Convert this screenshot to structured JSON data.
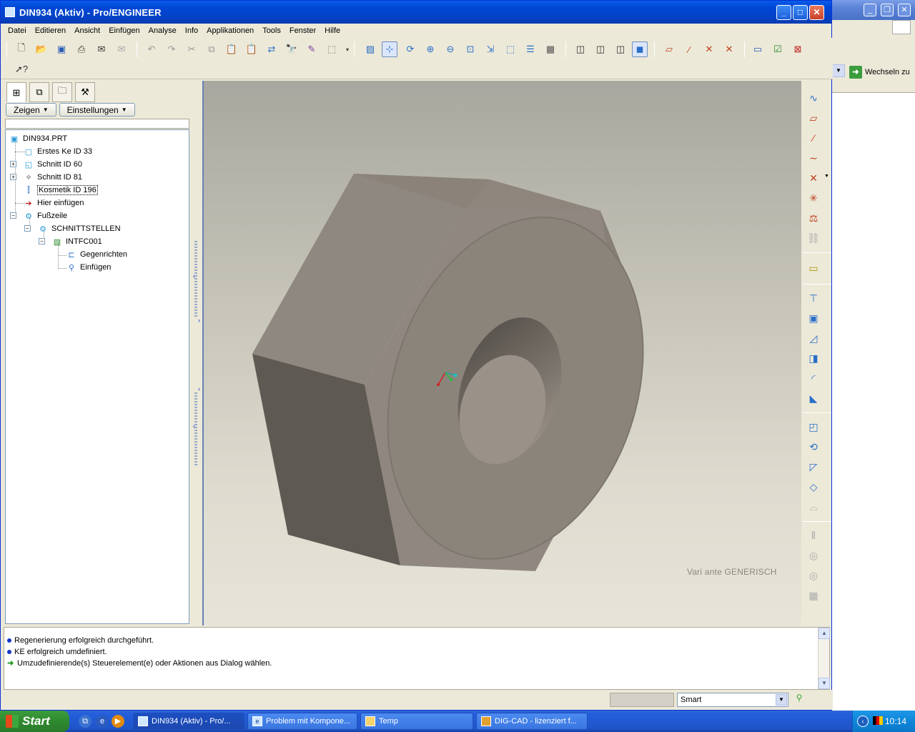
{
  "window": {
    "title": "DIN934 (Aktiv) - Pro/ENGINEER",
    "minimize": "_",
    "maximize": "□",
    "close": "✕"
  },
  "background_window": {
    "switch_label": "Wechseln zu"
  },
  "menu": [
    "Datei",
    "Editieren",
    "Ansicht",
    "Einfügen",
    "Analyse",
    "Info",
    "Applikationen",
    "Tools",
    "Fenster",
    "Hilfe"
  ],
  "left_panel": {
    "show_button": "Zeigen",
    "settings_button": "Einstellungen",
    "tree": [
      {
        "label": "DIN934.PRT",
        "icon": "part-icon"
      },
      {
        "label": "Erstes Ke ID 33",
        "icon": "feature-icon"
      },
      {
        "label": "Schnitt ID 60",
        "icon": "cut-icon"
      },
      {
        "label": "Schnitt ID 81",
        "icon": "revolve-cut-icon"
      },
      {
        "label": "Kosmetik ID 196",
        "icon": "cosmetic-icon"
      },
      {
        "label": "Hier einfügen",
        "icon": "insert-here-icon"
      },
      {
        "label": "Fußzeile",
        "icon": "footer-icon"
      },
      {
        "label": "SCHNITTSTELLEN",
        "icon": "interfaces-icon"
      },
      {
        "label": "INTFC001",
        "icon": "interface-icon"
      },
      {
        "label": "Gegenrichten",
        "icon": "align-icon"
      },
      {
        "label": "Einfügen",
        "icon": "insert-icon"
      }
    ]
  },
  "viewport": {
    "variant_label": "Vari ante GENERISCH",
    "body_color": "#8f877e"
  },
  "messages": [
    "Regenerierung erfolgreich durchgeführt.",
    "KE erfolgreich umdefiniert.",
    "Umzudefinierende(s) Steuerelement(e) oder Aktionen aus Dialog wählen."
  ],
  "status": {
    "filter_value": "Smart"
  },
  "taskbar": {
    "start": "Start",
    "tasks": [
      "DIN934 (Aktiv) - Pro/...",
      "Problem mit Kompone...",
      "Temp",
      "DIG-CAD - lizenziert f..."
    ],
    "clock": "10:14"
  }
}
